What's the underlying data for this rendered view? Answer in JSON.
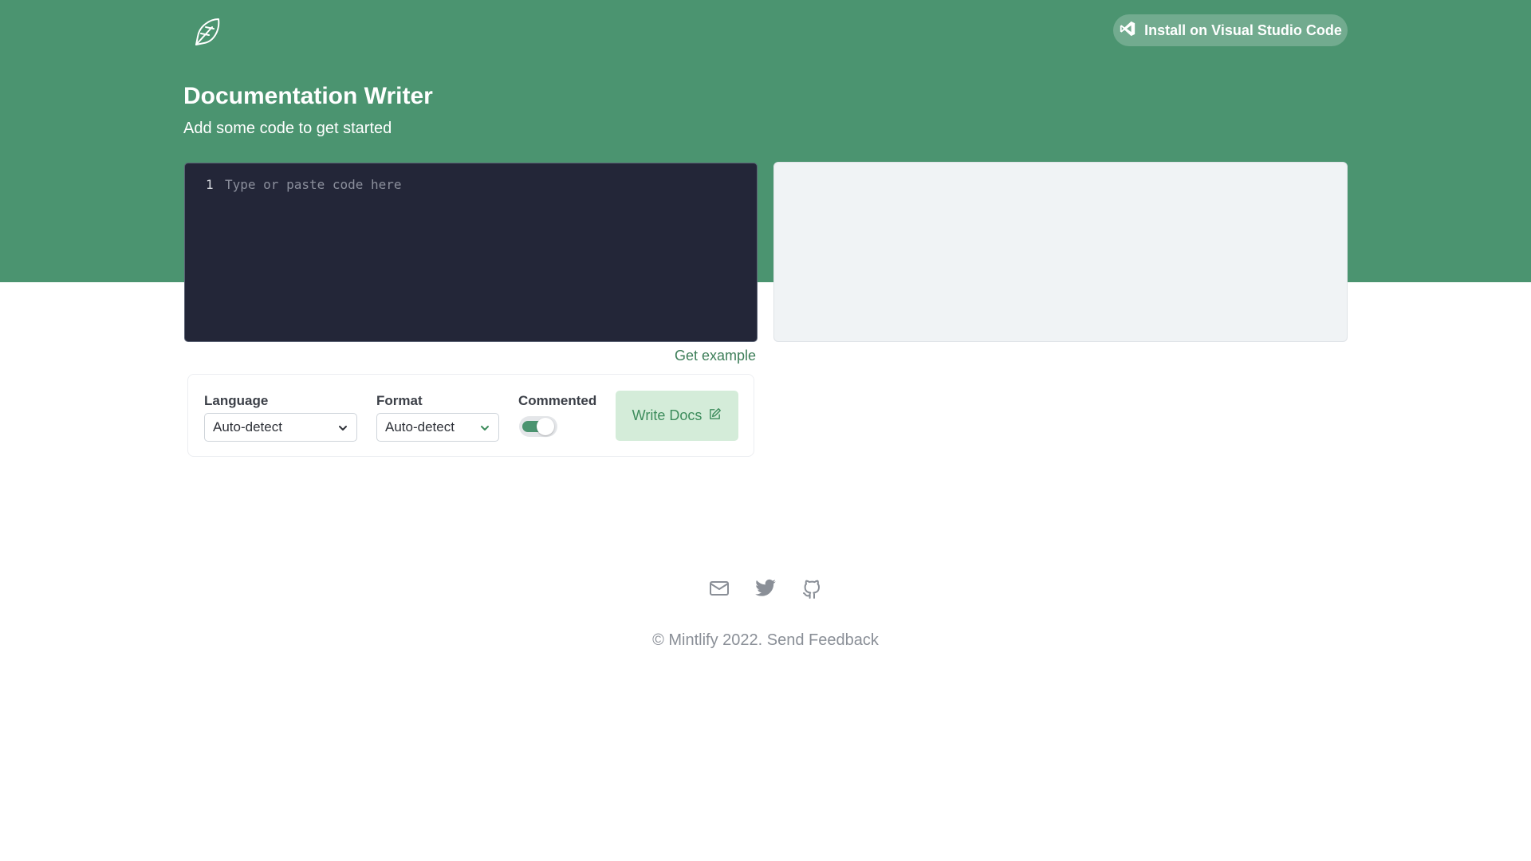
{
  "header": {
    "logo_icon": "feather-pen-icon",
    "install_button": {
      "icon": "vscode-icon",
      "label": "Install on Visual Studio Code"
    }
  },
  "hero": {
    "title": "Documentation Writer",
    "subtitle": "Add some code to get started"
  },
  "editor": {
    "line_number": "1",
    "placeholder": "Type or paste code here"
  },
  "get_example_label": "Get example",
  "options": {
    "language": {
      "label": "Language",
      "value": "Auto-detect"
    },
    "format": {
      "label": "Format",
      "value": "Auto-detect"
    },
    "commented": {
      "label": "Commented",
      "on": true
    },
    "write_button": {
      "label": "Write Docs",
      "icon": "edit-icon"
    }
  },
  "footer": {
    "social_icons": [
      "mail-icon",
      "twitter-icon",
      "github-icon"
    ],
    "copyright": "© Mintlify 2022.",
    "feedback_link": "Send Feedback"
  },
  "colors": {
    "accent": "#4b9470",
    "editor_bg": "#232638",
    "output_bg": "#f0f3f5",
    "button_bg": "#d4ecd9"
  }
}
